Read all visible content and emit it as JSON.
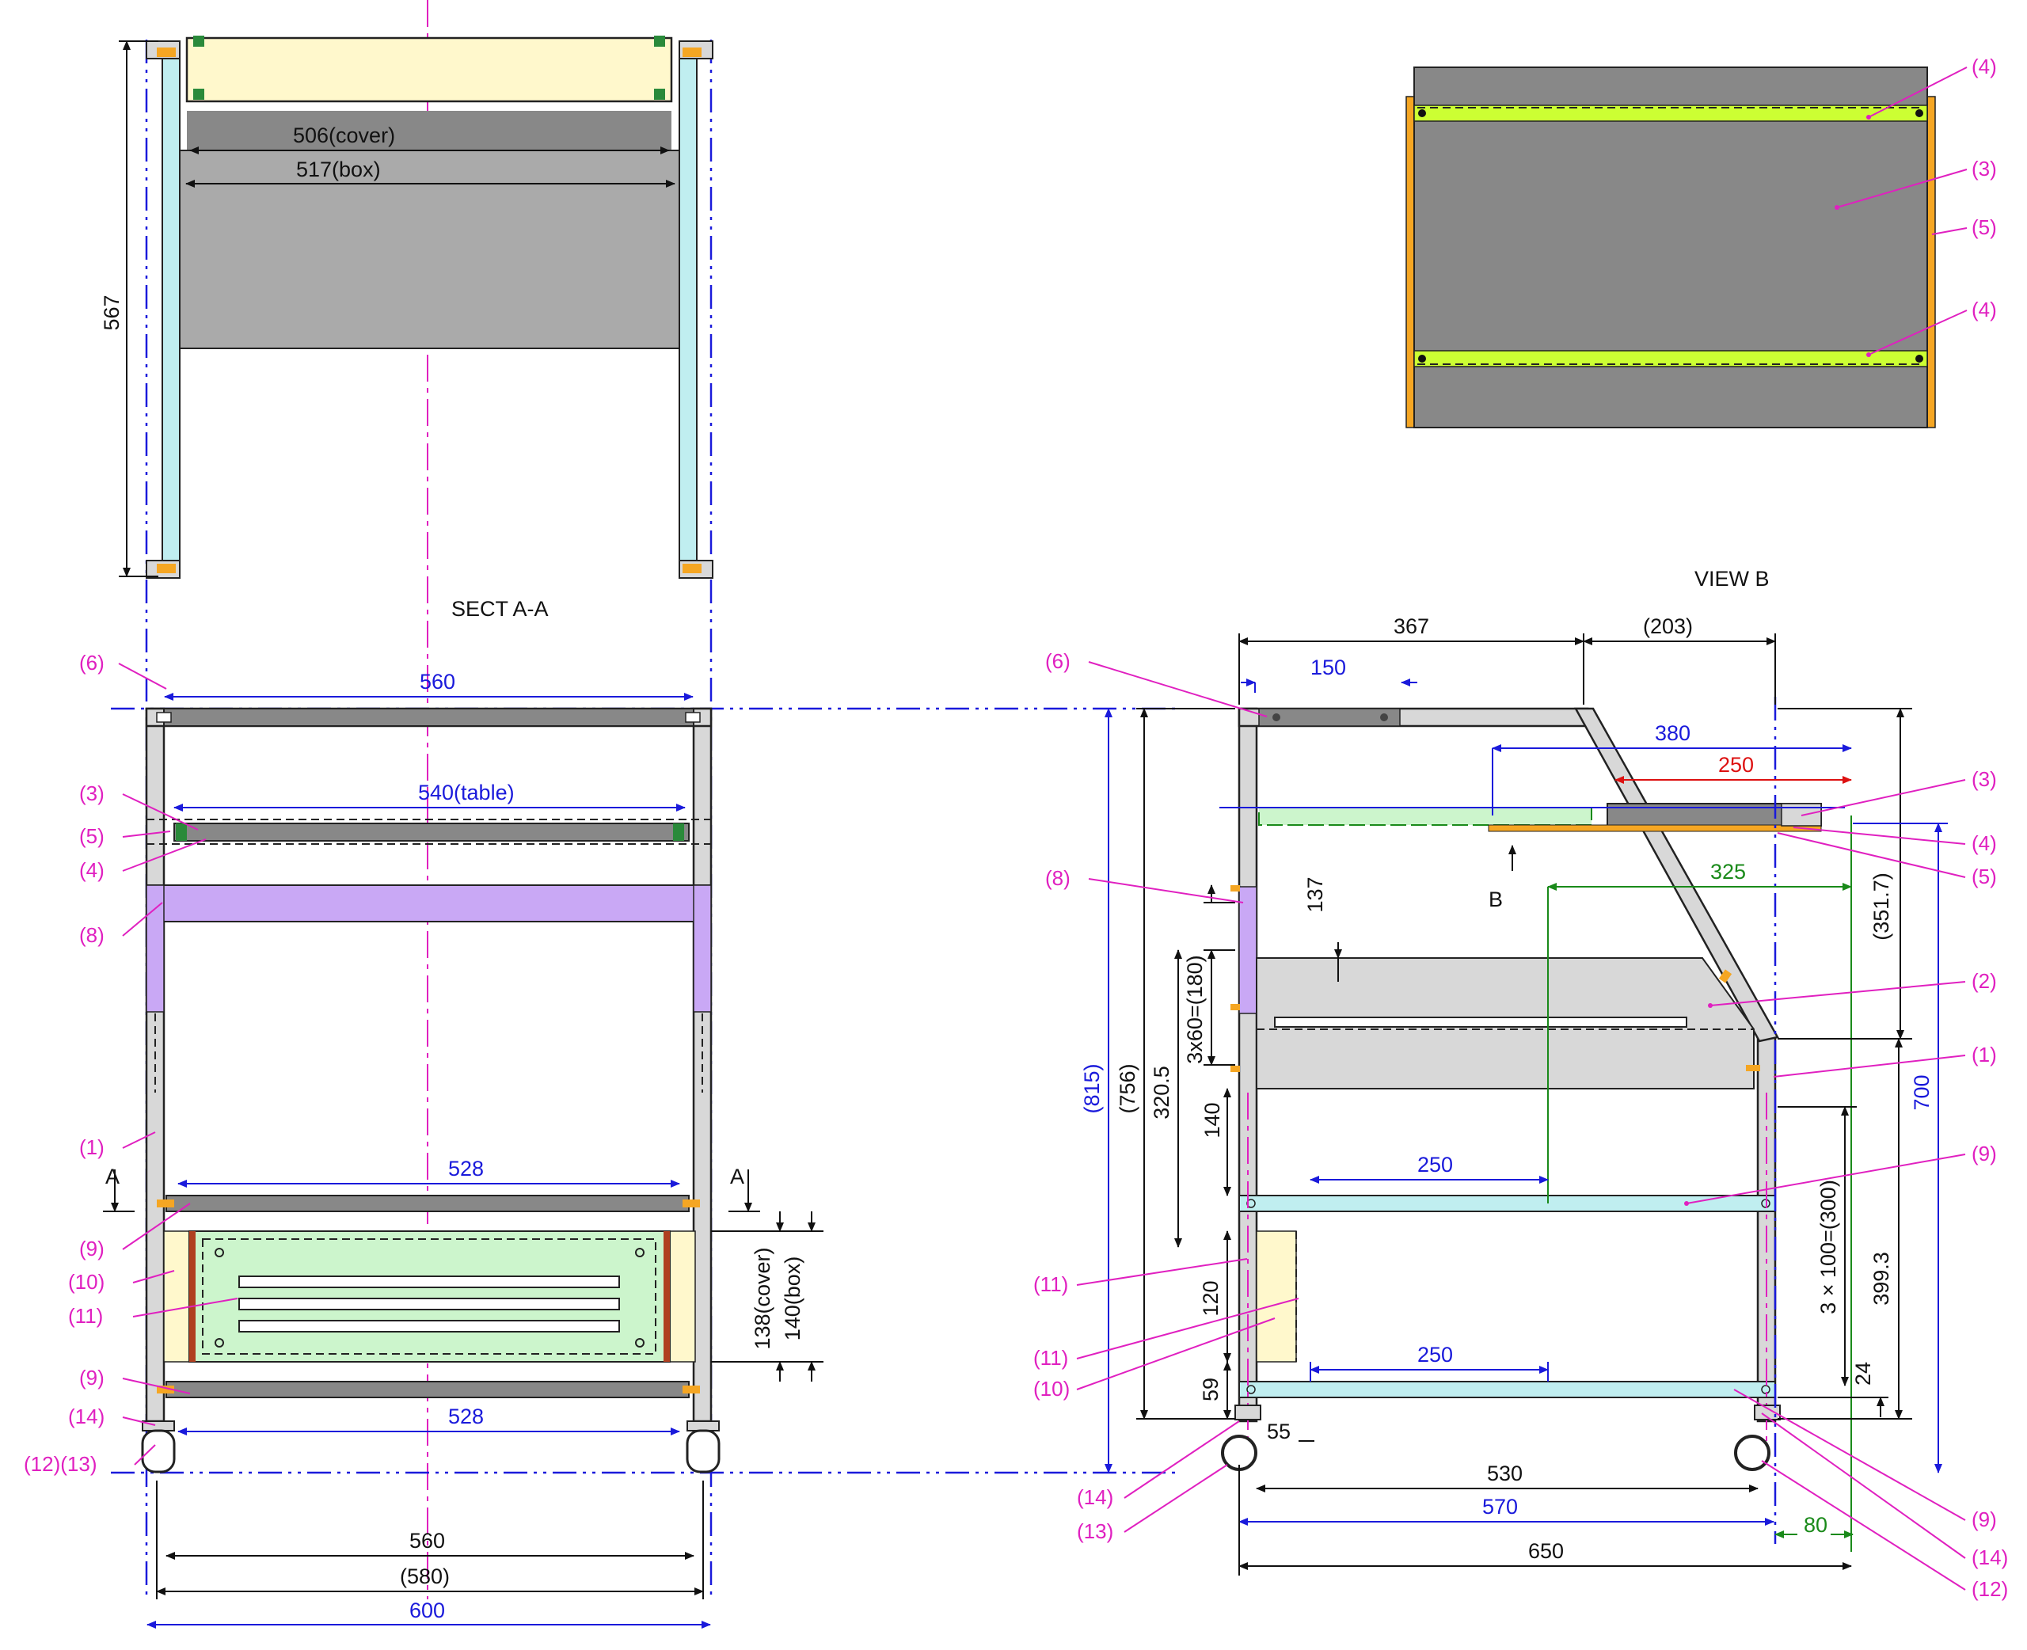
{
  "views": {
    "sect_title": "SECT A-A",
    "view_b_title": "VIEW B",
    "section_mark": "A",
    "view_mark": "B"
  },
  "section_view": {
    "dim_cover": "506(cover)",
    "dim_box": "517(box)",
    "dim_height": "567"
  },
  "front_view": {
    "dim_560_top": "560",
    "dim_table": "540(table)",
    "dim_528_top": "528",
    "dim_528_bottom": "528",
    "dim_cover_h": "138(cover)",
    "dim_box_h": "140(box)",
    "dim_560_bottom": "560",
    "dim_580": "(580)",
    "dim_600": "600"
  },
  "side_view": {
    "dim_367": "367",
    "dim_203": "(203)",
    "dim_150": "150",
    "dim_380": "380",
    "dim_250_red": "250",
    "dim_325": "325",
    "dim_137": "137",
    "dim_3x60": "3x60=(180)",
    "dim_320_5": "320.5",
    "dim_756": "(756)",
    "dim_815": "(815)",
    "dim_140": "140",
    "dim_250_mid": "250",
    "dim_120": "120",
    "dim_250_low": "250",
    "dim_59": "59",
    "dim_55": "55",
    "dim_530": "530",
    "dim_570": "570",
    "dim_80": "80",
    "dim_650": "650",
    "dim_351_7": "(351.7)",
    "dim_700": "700",
    "dim_3x100": "3 × 100=(300)",
    "dim_399_3": "399.3",
    "dim_24": "24"
  },
  "part_labels": {
    "p1": "(1)",
    "p2": "(2)",
    "p3": "(3)",
    "p4": "(4)",
    "p5": "(5)",
    "p6": "(6)",
    "p8": "(8)",
    "p9": "(9)",
    "p10": "(10)",
    "p11": "(11)",
    "p12": "(12)",
    "p13": "(13)",
    "p14": "(14)",
    "p12_13": "(12)(13)"
  },
  "colors": {
    "dimension_blue": "#1a1adb",
    "dimension_green": "#1a8a1a",
    "dimension_red": "#dd1111",
    "leader_magenta": "#e020c0",
    "frame_gray": "#d8d8d8",
    "panel_dark": "#888888",
    "cover_gray": "#aaaaaa",
    "box_green": "#ccf5cc",
    "rail_yellow": "#ccff33",
    "bracket_orange": "#f5a623",
    "shelf_purple": "#c9a8f5",
    "cyan_post": "#c0eef0",
    "cream": "#fff8cc"
  }
}
